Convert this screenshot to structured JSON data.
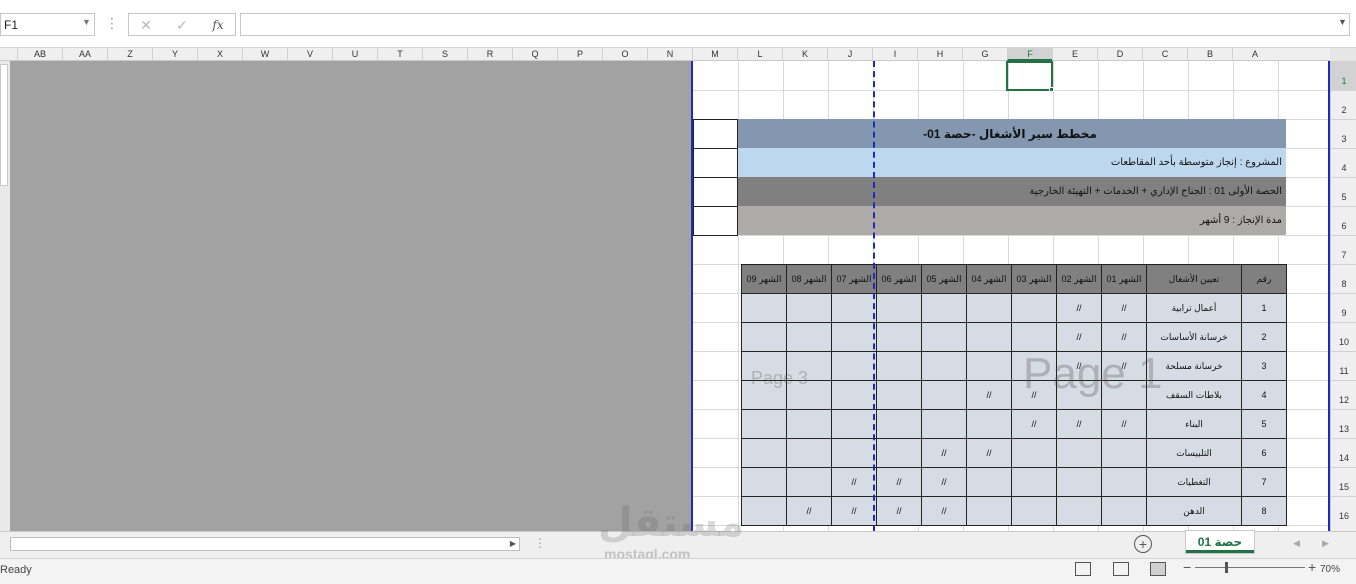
{
  "formula_bar": {
    "name_box": "F1",
    "cancel_icon": "✕",
    "enter_icon": "✓",
    "fx_label": "fx",
    "formula_value": ""
  },
  "columns": [
    "AB",
    "AA",
    "Z",
    "Y",
    "X",
    "W",
    "V",
    "U",
    "T",
    "S",
    "R",
    "Q",
    "P",
    "O",
    "N",
    "M",
    "L",
    "K",
    "J",
    "I",
    "H",
    "G",
    "F",
    "E",
    "D",
    "C",
    "B",
    "A"
  ],
  "selected_column": "F",
  "rows": [
    "1",
    "2",
    "3",
    "4",
    "5",
    "6",
    "7",
    "8",
    "9",
    "10",
    "11",
    "12",
    "13",
    "14",
    "15",
    "16"
  ],
  "selected_row": "1",
  "sheet": {
    "title": "مخطط سير الأشغال -حصة 01-",
    "project": "المشروع : إنجاز متوسطة بأحد المقاطعات",
    "phase": "الحصة الأولى 01 : الجناح الإداري + الخدمات + التهيئة الخارجية",
    "duration": "مدة الإنجاز : 9 أشهر",
    "table_headers": {
      "number": "رقم",
      "task": "تعيين الأشغال",
      "months": [
        "الشهر 01",
        "الشهر 02",
        "الشهر 03",
        "الشهر 04",
        "الشهر 05",
        "الشهر 06",
        "الشهر 07",
        "الشهر 08",
        "الشهر 09"
      ]
    },
    "table_rows": [
      {
        "num": "1",
        "task": "أعمال ترابية",
        "marks": [
          "//",
          "//",
          "",
          "",
          "",
          "",
          "",
          "",
          ""
        ]
      },
      {
        "num": "2",
        "task": "خرسانة الأساسات",
        "marks": [
          "//",
          "//",
          "",
          "",
          "",
          "",
          "",
          "",
          ""
        ]
      },
      {
        "num": "3",
        "task": "خرسانة مسلحة",
        "marks": [
          "//",
          "//",
          "",
          "",
          "",
          "",
          "",
          "",
          ""
        ]
      },
      {
        "num": "4",
        "task": "بلاطات السقف",
        "marks": [
          "",
          "",
          "//",
          "//",
          "",
          "",
          "",
          "",
          ""
        ]
      },
      {
        "num": "5",
        "task": "البناء",
        "marks": [
          "//",
          "//",
          "//",
          "",
          "",
          "",
          "",
          "",
          ""
        ]
      },
      {
        "num": "6",
        "task": "التلبيسات",
        "marks": [
          "",
          "",
          "",
          "//",
          "//",
          "",
          "",
          "",
          ""
        ]
      },
      {
        "num": "7",
        "task": "التغطيات",
        "marks": [
          "",
          "",
          "",
          "",
          "//",
          "//",
          "//",
          "",
          ""
        ]
      },
      {
        "num": "8",
        "task": "الدهن",
        "marks": [
          "",
          "",
          "",
          "",
          "//",
          "//",
          "//",
          "//",
          ""
        ]
      }
    ],
    "watermark_page1": "Page 1",
    "watermark_page3": "Page 3"
  },
  "tabs": {
    "sheet_name": "حصة 01",
    "add_label": "+"
  },
  "status": {
    "text": "Ready",
    "zoom": "70%"
  },
  "watermark": {
    "logo": "مستقل",
    "url": "mostaql.com"
  }
}
